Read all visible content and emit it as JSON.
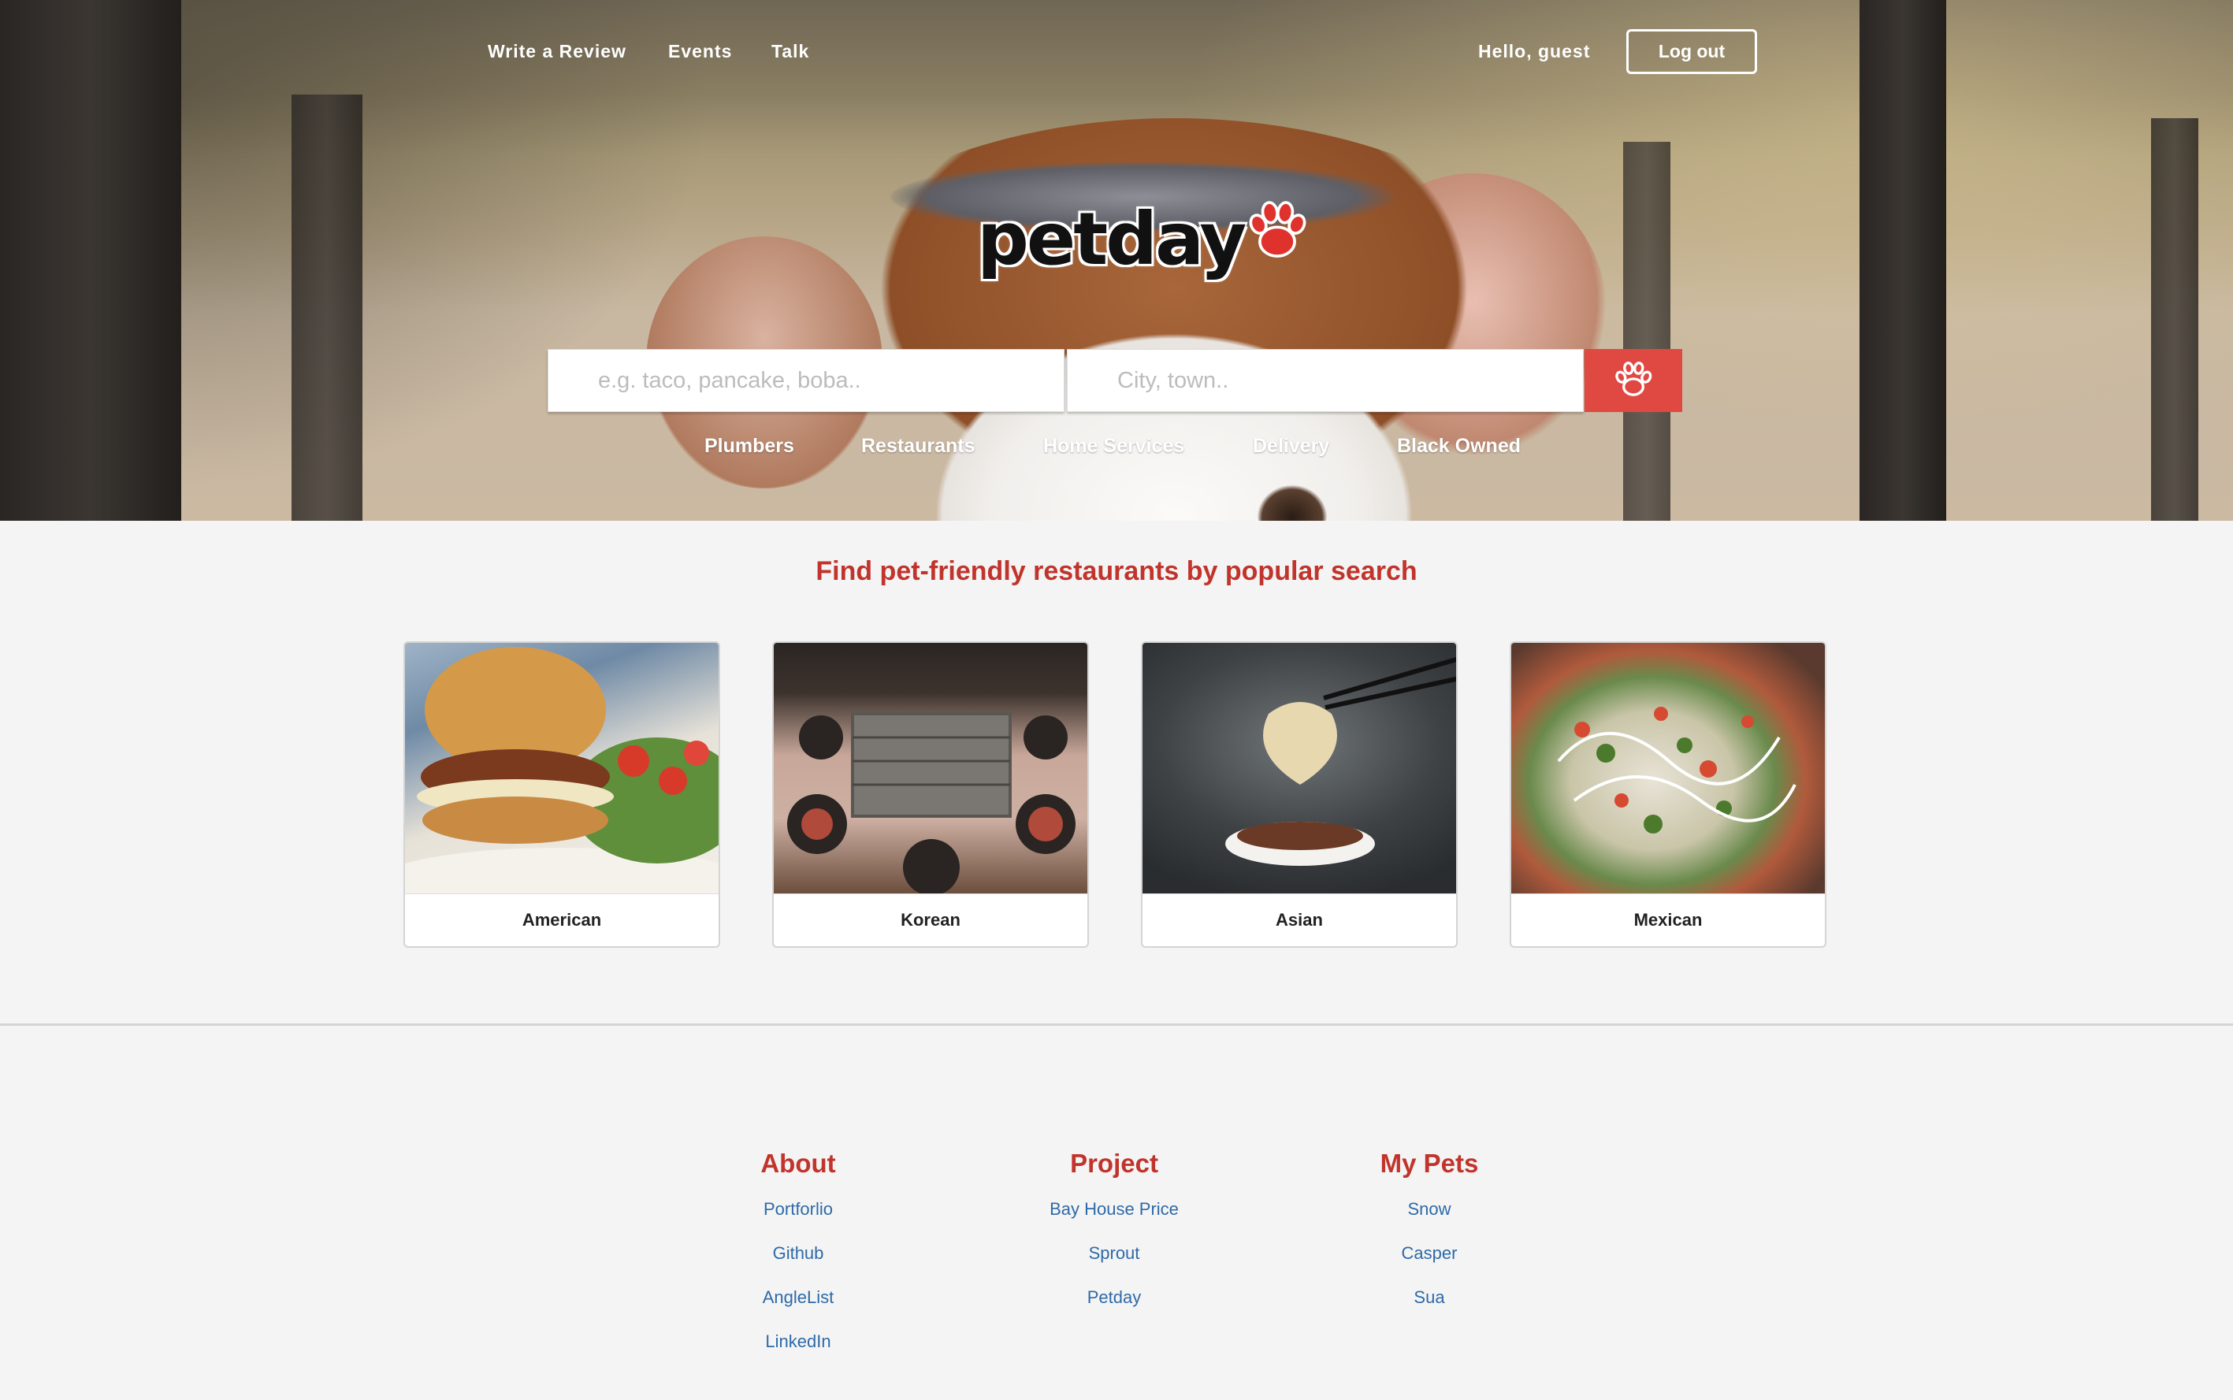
{
  "nav": {
    "links": [
      "Write a Review",
      "Events",
      "Talk"
    ],
    "greeting": "Hello, guest",
    "logout_label": "Log out"
  },
  "logo": {
    "text": "petday",
    "icon": "paw-icon",
    "paw_color": "#e0322c"
  },
  "search": {
    "what_placeholder": "e.g. taco, pancake, boba..",
    "where_placeholder": "City, town..",
    "button_icon": "paw-icon",
    "button_color": "#e04842"
  },
  "categories": [
    "Plumbers",
    "Restaurants",
    "Home Services",
    "Delivery",
    "Black Owned"
  ],
  "popular": {
    "title": "Find pet-friendly restaurants by popular search",
    "cards": [
      {
        "label": "American",
        "image": "burger-photo"
      },
      {
        "label": "Korean",
        "image": "korean-bbq-photo"
      },
      {
        "label": "Asian",
        "image": "dumpling-photo"
      },
      {
        "label": "Mexican",
        "image": "nachos-photo"
      }
    ]
  },
  "footer": {
    "columns": [
      {
        "title": "About",
        "links": [
          "Portforlio",
          "Github",
          "AngleList",
          "LinkedIn"
        ]
      },
      {
        "title": "Project",
        "links": [
          "Bay House Price",
          "Sprout",
          "Petday"
        ]
      },
      {
        "title": "My Pets",
        "links": [
          "Snow",
          "Casper",
          "Sua"
        ]
      }
    ]
  },
  "colors": {
    "accent_red": "#c1342c",
    "link_blue": "#2e6aa8",
    "page_bg": "#f4f4f4"
  }
}
